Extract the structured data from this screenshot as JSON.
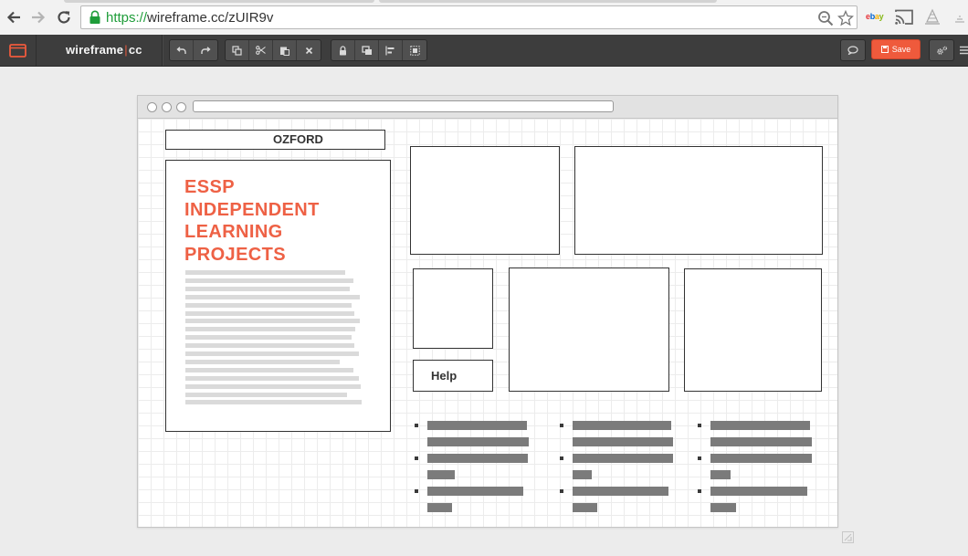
{
  "browser": {
    "url_scheme": "https://",
    "url_rest": "wireframe.cc/zUIR9v",
    "extension_label": "ebay",
    "colors": {
      "secure_green": "#1f9d3a",
      "ebay_e": "#e53238",
      "ebay_b": "#0064d2",
      "ebay_a": "#f5af02",
      "ebay_y": "#86b817"
    }
  },
  "toolbar": {
    "logo_left": "wireframe",
    "logo_sep": "|",
    "logo_right": "cc",
    "save_label": "Save",
    "icons": {
      "app_menu": "window-icon",
      "undo": "undo-icon",
      "redo": "redo-icon",
      "copy": "copy-icon",
      "cut": "scissors-icon",
      "paste": "paste-icon",
      "delete": "delete-icon",
      "lock": "lock-icon",
      "duplicate": "duplicate-icon",
      "align": "align-icon",
      "group": "group-icon",
      "comment": "comment-icon",
      "settings": "gears-icon"
    },
    "colors": {
      "background": "#3d3d3d",
      "save": "#ef5a3c",
      "logo_accent": "#e85b3e"
    }
  },
  "wireframe": {
    "brand": "OZFORD",
    "hero_title_lines": [
      "ESSP",
      "INDEPENDENT",
      "LEARNING",
      "PROJECTS"
    ],
    "help_label": "Help",
    "colors": {
      "accent": "#ee6145",
      "text_placeholder": "#dadada",
      "list_bar": "#7b7b7b"
    }
  }
}
